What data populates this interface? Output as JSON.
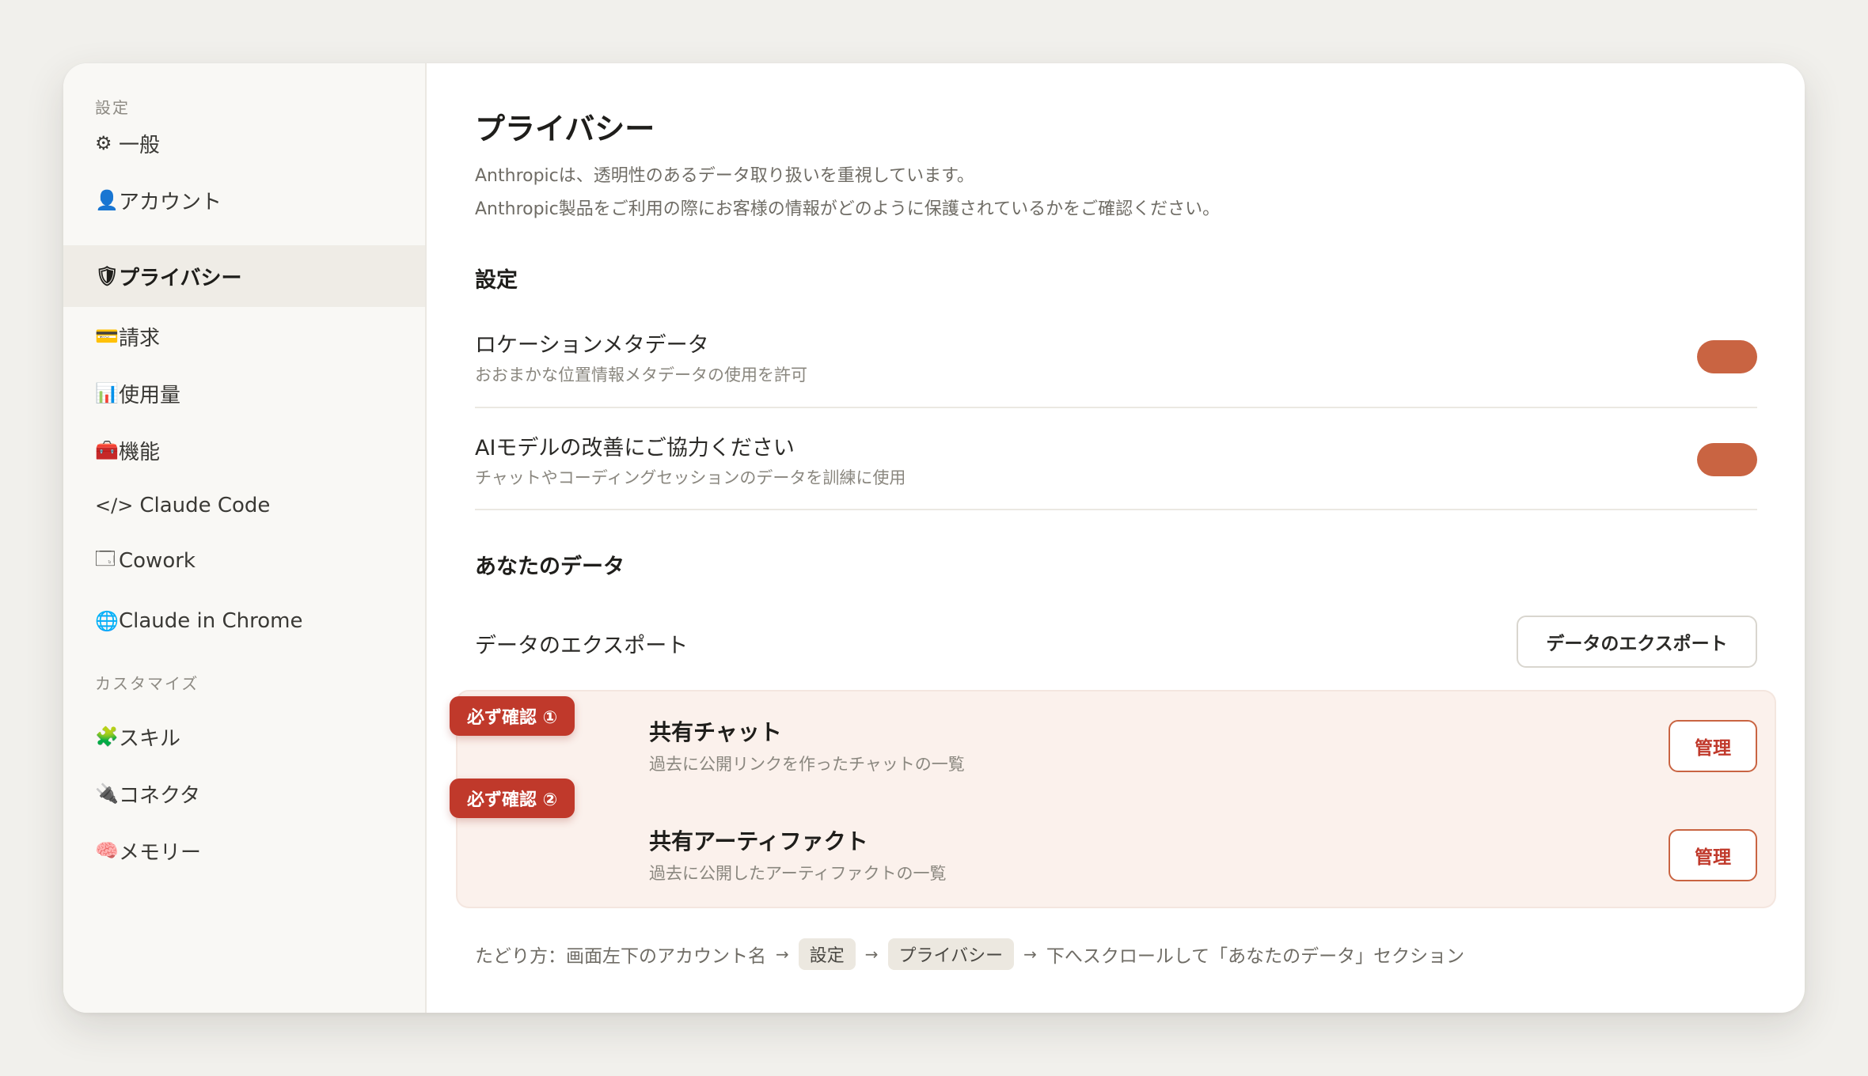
{
  "sidebar": {
    "section_settings": "設定",
    "section_customize": "カスタマイズ",
    "items": [
      {
        "icon": "⚙",
        "label": "一般"
      },
      {
        "icon": "👤",
        "label": "アカウント"
      },
      {
        "icon": "🛡",
        "label": "プライバシー"
      },
      {
        "icon": "💳",
        "label": "請求"
      },
      {
        "icon": "📊",
        "label": "使用量"
      },
      {
        "icon": "🧰",
        "label": "機能"
      },
      {
        "icon": "</>",
        "label": "Claude Code"
      },
      {
        "icon": "🗔",
        "label": "Cowork"
      },
      {
        "icon": "🌐",
        "label": "Claude in Chrome"
      }
    ],
    "custom_items": [
      {
        "icon": "🧩",
        "label": "スキル"
      },
      {
        "icon": "🔌",
        "label": "コネクタ"
      },
      {
        "icon": "🧠",
        "label": "メモリー"
      }
    ]
  },
  "main": {
    "title": "プライバシー",
    "desc_line1": "Anthropicは、透明性のあるデータ取り扱いを重視しています。",
    "desc_line2": "Anthropic製品をご利用の際にお客様の情報がどのように保護されているかをご確認ください。",
    "settings_heading": "設定",
    "location": {
      "title": "ロケーションメタデータ",
      "sub": "おおまかな位置情報メタデータの使用を許可",
      "enabled": true
    },
    "improve": {
      "title": "AIモデルの改善にご協力ください",
      "sub": "チャットやコーディングセッションのデータを訓練に使用",
      "enabled": true
    },
    "your_data_heading": "あなたのデータ",
    "export": {
      "label": "データのエクスポート",
      "button": "データのエクスポート"
    },
    "shared_chats": {
      "badge": "必ず確認 ①",
      "title": "共有チャット",
      "sub": "過去に公開リンクを作ったチャットの一覧",
      "button": "管理"
    },
    "shared_artifacts": {
      "badge": "必ず確認 ②",
      "title": "共有アーティファクト",
      "sub": "過去に公開したアーティファクトの一覧",
      "button": "管理"
    },
    "path": {
      "prefix": "たどり方：画面左下のアカウント名",
      "chip1": "設定",
      "chip2": "プライバシー",
      "suffix": "下へスクロールして「あなたのデータ」セクション",
      "arrow": "→"
    }
  },
  "colors": {
    "accent": "#c96442",
    "badge": "#c0392b",
    "highlight_bg": "#fbf1ec",
    "sidebar_bg": "#f9f8f5",
    "page_bg": "#f1f0ec"
  }
}
